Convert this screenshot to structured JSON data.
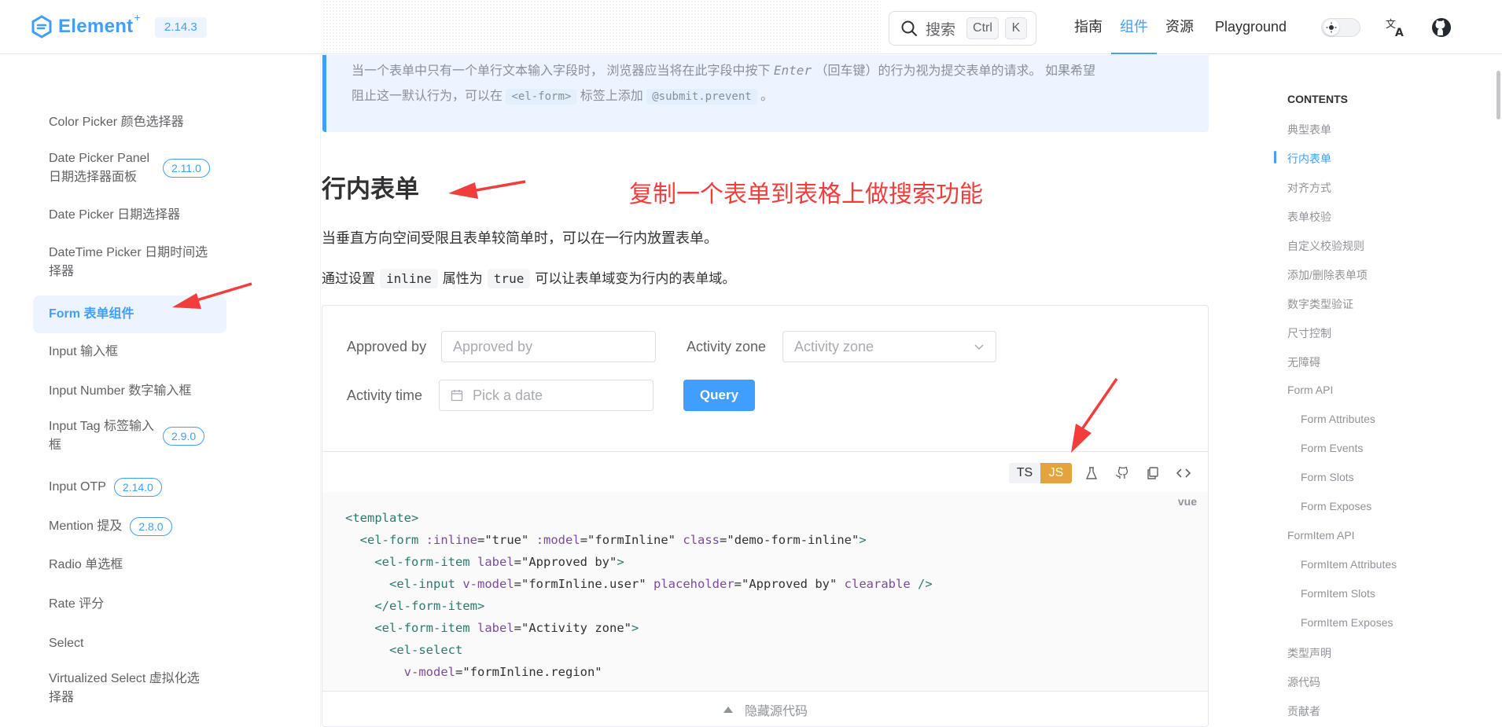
{
  "header": {
    "logo_text": "Element",
    "logo_sup": "+",
    "version": "2.14.3",
    "search": {
      "label": "搜索",
      "key1": "Ctrl",
      "key2": "K"
    },
    "nav": [
      "指南",
      "组件",
      "资源",
      "Playground"
    ],
    "active_nav": "组件"
  },
  "sidebar": {
    "items": [
      {
        "label": "Color Picker 颜色选择器"
      },
      {
        "label": "Date Picker Panel 日期选择器面板",
        "badge": "2.11.0"
      },
      {
        "label": "Date Picker 日期选择器"
      },
      {
        "label": "DateTime Picker 日期时间选择器"
      },
      {
        "label": "Form 表单组件"
      },
      {
        "label": "Input 输入框"
      },
      {
        "label": "Input Number 数字输入框"
      },
      {
        "label": "Input Tag 标签输入框",
        "badge": "2.9.0"
      },
      {
        "label": "Input OTP",
        "badge": "2.14.0"
      },
      {
        "label": "Mention 提及",
        "badge": "2.8.0"
      },
      {
        "label": "Radio 单选框"
      },
      {
        "label": "Rate 评分"
      },
      {
        "label": "Select"
      },
      {
        "label": "Virtualized Select 虚拟化选择器"
      }
    ],
    "active": "Form 表单组件"
  },
  "tip": {
    "line1_a": "当一个表单中只有一个单行文本输入字段时， 浏览器应当将在此字段中按下",
    "line1_key": "Enter",
    "line1_b": "（回车键）的行为视为提交表单的请求。 如果希望",
    "line2_a": "阻止这一默认行为，可以在",
    "code1": "<el-form>",
    "line2_b": "标签上添加",
    "code2": "@submit.prevent",
    "line2_c": "。"
  },
  "section": {
    "title": "行内表单",
    "annotation": "复制一个表单到表格上做搜索功能",
    "desc": "当垂直方向空间受限且表单较简单时，可以在一行内放置表单。",
    "setting_a": "通过设置",
    "setting_code1": "inline",
    "setting_b": "属性为",
    "setting_code2": "true",
    "setting_c": "可以让表单域变为行内的表单域。"
  },
  "demo": {
    "approved_label": "Approved by",
    "approved_placeholder": "Approved by",
    "zone_label": "Activity zone",
    "zone_placeholder": "Activity zone",
    "time_label": "Activity time",
    "time_placeholder": "Pick a date",
    "query": "Query",
    "lang_ts": "TS",
    "lang_js": "JS",
    "code_lang": "vue",
    "hide_source": "隐藏源代码"
  },
  "toc": {
    "heading": "CONTENTS",
    "items": [
      {
        "label": "典型表单",
        "level": 1
      },
      {
        "label": "行内表单",
        "level": 1
      },
      {
        "label": "对齐方式",
        "level": 1
      },
      {
        "label": "表单校验",
        "level": 1
      },
      {
        "label": "自定义校验规则",
        "level": 1
      },
      {
        "label": "添加/删除表单项",
        "level": 1
      },
      {
        "label": "数字类型验证",
        "level": 1
      },
      {
        "label": "尺寸控制",
        "level": 1
      },
      {
        "label": "无障碍",
        "level": 1
      },
      {
        "label": "Form API",
        "level": 1
      },
      {
        "label": "Form Attributes",
        "level": 2
      },
      {
        "label": "Form Events",
        "level": 2
      },
      {
        "label": "Form Slots",
        "level": 2
      },
      {
        "label": "Form Exposes",
        "level": 2
      },
      {
        "label": "FormItem API",
        "level": 1
      },
      {
        "label": "FormItem Attributes",
        "level": 2
      },
      {
        "label": "FormItem Slots",
        "level": 2
      },
      {
        "label": "FormItem Exposes",
        "level": 2
      },
      {
        "label": "类型声明",
        "level": 1
      },
      {
        "label": "源代码",
        "level": 1
      },
      {
        "label": "贡献者",
        "level": 1
      }
    ],
    "active": "行内表单"
  },
  "colors": {
    "brand": "#409eff",
    "annotation": "#f23d3d",
    "js_badge": "#e6a23c"
  }
}
